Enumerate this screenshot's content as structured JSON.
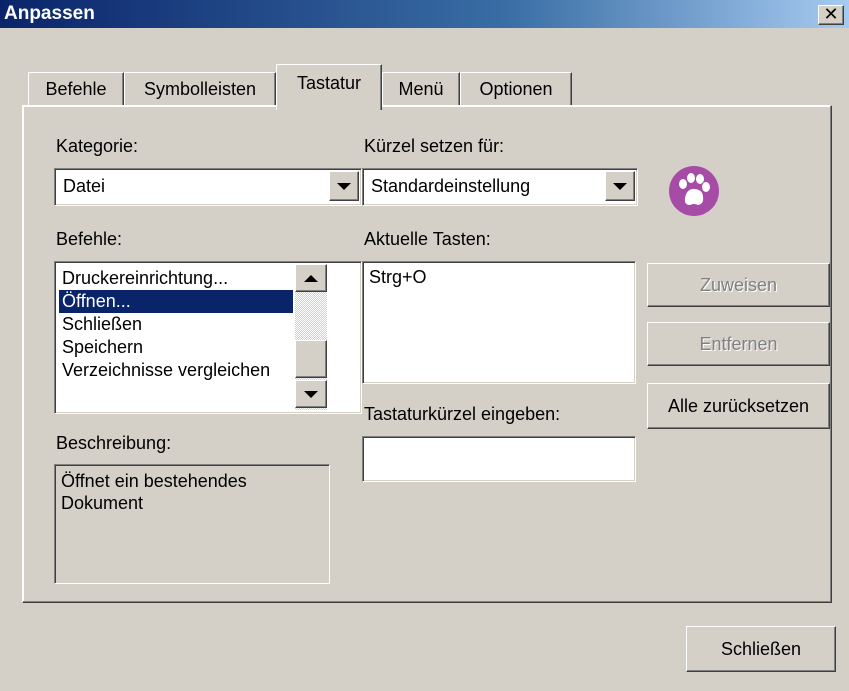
{
  "window": {
    "title": "Anpassen",
    "close_glyph": "✕"
  },
  "tabs": [
    {
      "label": "Befehle"
    },
    {
      "label": "Symbolleisten"
    },
    {
      "label": "Tastatur"
    },
    {
      "label": "Menü"
    },
    {
      "label": "Optionen"
    }
  ],
  "kategorie": {
    "label": "Kategorie:",
    "value": "Datei"
  },
  "befehle": {
    "label": "Befehle:",
    "items": [
      "Druckereinrichtung...",
      "Öffnen...",
      "Schließen",
      "Speichern",
      "Verzeichnisse vergleichen"
    ],
    "selected_index": 1
  },
  "beschreibung": {
    "label": "Beschreibung:",
    "text_line1": "Öffnet ein bestehendes",
    "text_line2": "Dokument"
  },
  "kuerzel": {
    "label": "Kürzel setzen für:",
    "value": "Standardeinstellung"
  },
  "aktuelle_tasten": {
    "label": "Aktuelle Tasten:",
    "items": [
      "Strg+O"
    ]
  },
  "eingabe": {
    "label": "Tastaturkürzel eingeben:",
    "value": ""
  },
  "buttons": {
    "zuweisen": "Zuweisen",
    "entfernen": "Entfernen",
    "alle_zuruecksetzen": "Alle zurücksetzen",
    "schliessen": "Schließen"
  },
  "colors": {
    "accent": "#0a246a",
    "paw_bg": "#a64ca6"
  },
  "icons": {
    "paw": "paw-logo-icon"
  }
}
